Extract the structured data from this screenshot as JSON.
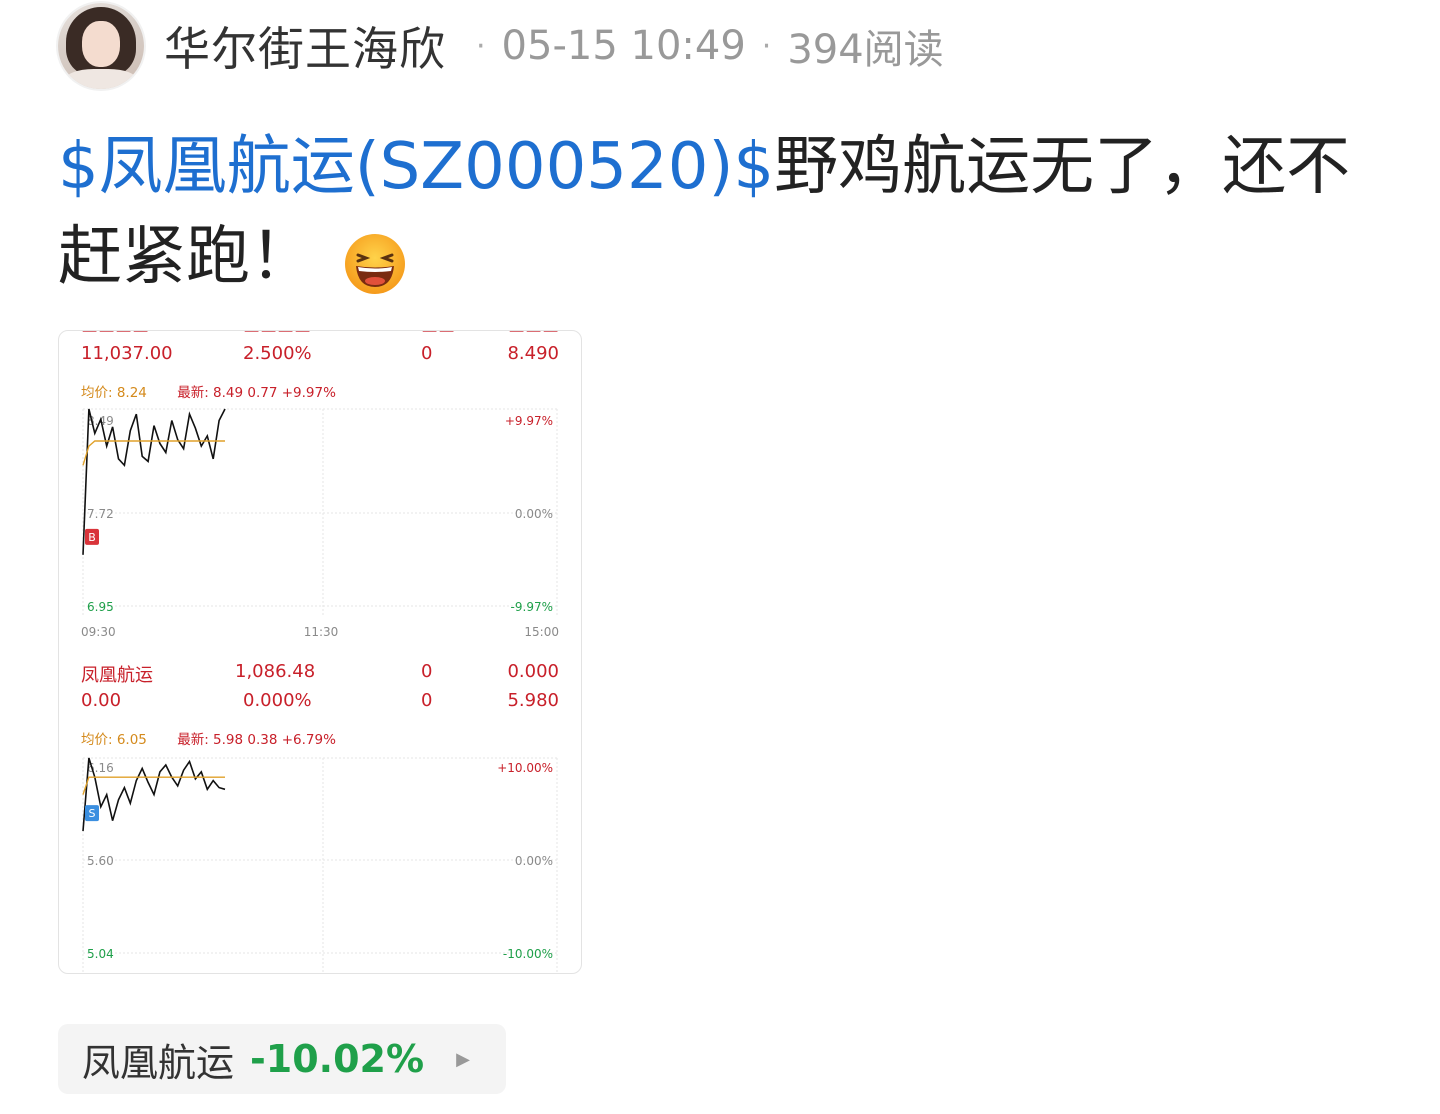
{
  "header": {
    "author": "华尔街王海欣",
    "time": "05-15 10:49",
    "reads": "394阅读",
    "separator": "·"
  },
  "post": {
    "stock_tag": "$凤凰航运(SZ000520)$",
    "text": "野鸡航运无了，还不赶紧跑！",
    "emoji": "laughing-face-icon"
  },
  "chart1": {
    "row": [
      "11,037.00",
      "2.500%",
      "0",
      "8.490"
    ],
    "avg": "均价: 8.24",
    "latest": "最新: 8.49  0.77  +9.97%",
    "y_left": [
      "8.49",
      "7.72",
      "6.95"
    ],
    "y_right": [
      "+9.97%",
      "0.00%",
      "-9.97%"
    ],
    "x": [
      "09:30",
      "11:30",
      "15:00"
    ],
    "marker": "B"
  },
  "chart2": {
    "name": "凤凰航运",
    "row1": [
      "1,086.48",
      "0",
      "0.000"
    ],
    "row2": [
      "0.00",
      "0.000%",
      "0",
      "5.980"
    ],
    "avg": "均价: 6.05",
    "latest": "最新: 5.98  0.38  +6.79%",
    "y_left": [
      "6.16",
      "5.60",
      "5.04"
    ],
    "y_right": [
      "+10.00%",
      "0.00%",
      "-10.00%"
    ],
    "marker": "S"
  },
  "chip": {
    "name": "凤凰航运",
    "change": "-10.02%"
  },
  "colors": {
    "link": "#1e6fd0",
    "up": "#c8202a",
    "down": "#1fa04a",
    "avg_line": "#e0a12a",
    "buy_marker": "#d9343a",
    "sell_marker": "#3b8fe0"
  },
  "chart_data": [
    {
      "type": "line",
      "title": "",
      "series": [
        {
          "values": [
            7.35,
            8.49,
            8.3,
            8.41,
            8.2,
            8.35,
            8.1,
            8.05,
            8.32,
            8.45,
            8.12,
            8.08,
            8.36,
            8.22,
            8.15,
            8.4,
            8.25,
            8.18,
            8.45,
            8.34,
            8.2,
            8.28,
            8.1,
            8.4,
            8.49
          ]
        },
        {
          "values": [
            8.05,
            8.2,
            8.24,
            8.24,
            8.24,
            8.24,
            8.24,
            8.24,
            8.24,
            8.24,
            8.24,
            8.24,
            8.24,
            8.24,
            8.24,
            8.24,
            8.24,
            8.24,
            8.24,
            8.24,
            8.24,
            8.24,
            8.24,
            8.24,
            8.24
          ]
        }
      ],
      "ylim": [
        6.95,
        8.49
      ],
      "x_ticks": [
        "09:30",
        "11:30",
        "15:00"
      ]
    },
    {
      "type": "line",
      "title": "",
      "series": [
        {
          "values": [
            5.74,
            6.16,
            6.05,
            5.88,
            5.95,
            5.8,
            5.92,
            5.99,
            5.9,
            6.03,
            6.1,
            6.02,
            5.95,
            6.08,
            6.12,
            6.05,
            6.0,
            6.09,
            6.14,
            6.04,
            6.08,
            5.98,
            6.03,
            5.99,
            5.98
          ]
        },
        {
          "values": [
            5.95,
            6.05,
            6.05,
            6.05,
            6.05,
            6.05,
            6.05,
            6.05,
            6.05,
            6.05,
            6.05,
            6.05,
            6.05,
            6.05,
            6.05,
            6.05,
            6.05,
            6.05,
            6.05,
            6.05,
            6.05,
            6.05,
            6.05,
            6.05,
            6.05
          ]
        }
      ],
      "ylim": [
        5.04,
        6.16
      ]
    }
  ]
}
